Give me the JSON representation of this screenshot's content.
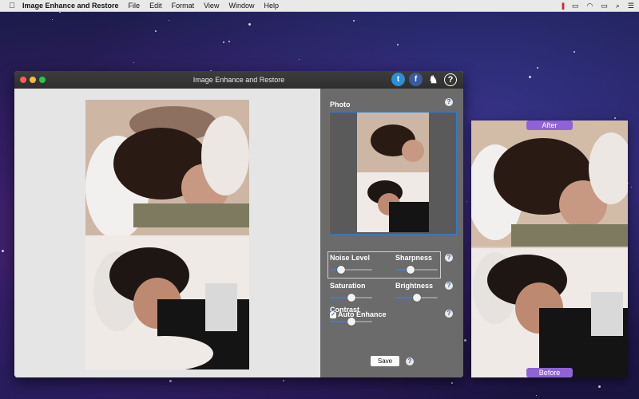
{
  "menubar": {
    "app_name": "Image Enhance and Restore",
    "menus": [
      "File",
      "Edit",
      "Format",
      "View",
      "Window",
      "Help"
    ]
  },
  "window": {
    "title": "Image Enhance and Restore"
  },
  "panel": {
    "photo_label": "Photo",
    "auto_enhance_label": "Auto Enhance",
    "auto_enhance_checked": true,
    "noise_level_label": "Noise Level",
    "sharpness_label": "Sharpness",
    "saturation_label": "Saturation",
    "brightness_label": "Brightness",
    "contrast_label": "Contrast",
    "save_label": "Save",
    "help_glyph": "?"
  },
  "sliders": {
    "noise_level": 0.2,
    "sharpness": 0.3,
    "saturation": 0.5,
    "brightness": 0.5,
    "contrast": 0.5
  },
  "side": {
    "after_label": "After",
    "before_label": "Before"
  },
  "colors": {
    "accent": "#3a7be0",
    "tag": "#8f63d6",
    "panel_bg": "#6b6b6b"
  }
}
